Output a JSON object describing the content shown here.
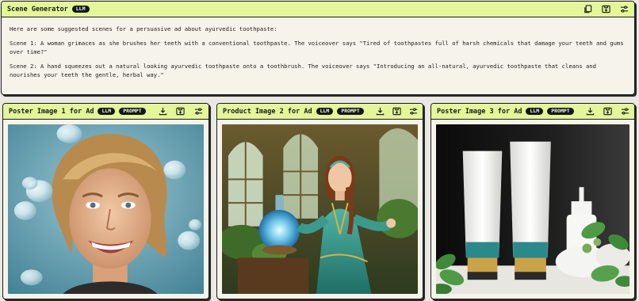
{
  "scene_generator": {
    "title": "Scene Generator",
    "badge": "LLM",
    "intro": "Here are some suggested scenes for a persuasive ad about ayurvedic toothpaste:",
    "scene1": "Scene 1: A woman grimaces as she brushes her teeth with a conventional toothpaste. The voiceover says \"Tired of toothpastes full of harsh chemicals that damage your teeth and gums over time?\"",
    "scene2": "Scene 2: A hand squeezes out a natural looking ayurvedic toothpaste onto a toothbrush. The voiceover says \"Introducing an all-natural, ayurvedic toothpaste that cleans and nourishes your teeth the gentle, herbal way.\"",
    "icons": [
      "copy-icon",
      "save-icon",
      "settings-sliders-icon"
    ]
  },
  "panels": [
    {
      "title": "Poster Image 1 for Ad",
      "badges": [
        "LLM",
        "PROMPT"
      ],
      "icons": [
        "download-icon",
        "save-icon",
        "settings-sliders-icon"
      ],
      "image": "smiling-woman-with-water-bubbles"
    },
    {
      "title": "Product Image 2 for Ad",
      "badges": [
        "LLM",
        "PROMPT"
      ],
      "icons": [
        "download-icon",
        "save-icon",
        "settings-sliders-icon"
      ],
      "image": "fantasy-woman-with-glowing-potion"
    },
    {
      "title": "Poster Image 3 for Ad",
      "badges": [
        "LLM",
        "PROMPT"
      ],
      "icons": [
        "download-icon",
        "save-icon",
        "settings-sliders-icon"
      ],
      "image": "toothpaste-tubes-with-herbs"
    }
  ],
  "colors": {
    "header_bg": "#e4f59a",
    "panel_bg": "#f6f4ea",
    "border": "#1b1b1b",
    "badge_bg": "#161616"
  }
}
